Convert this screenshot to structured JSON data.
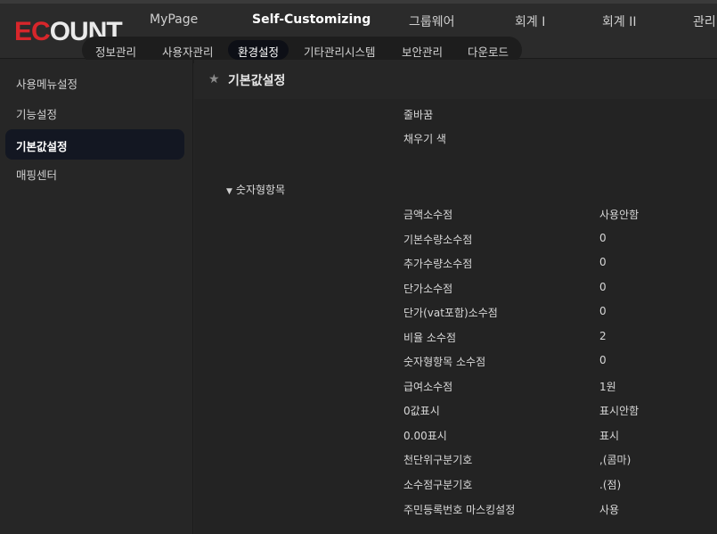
{
  "logo": {
    "part1": "EC",
    "part2": "OUNT"
  },
  "main_nav": [
    "MyPage",
    "Self-Customizing",
    "그룹웨어",
    "회계 I",
    "회계 II",
    "관리"
  ],
  "main_nav_active": "Self-Customizing",
  "sub_nav": [
    "정보관리",
    "사용자관리",
    "환경설정",
    "기타관리시스템",
    "보안관리",
    "다운로드"
  ],
  "sub_nav_active": "환경설정",
  "sidebar": [
    "사용메뉴설정",
    "기능설정",
    "기본값설정",
    "매핑센터"
  ],
  "sidebar_active": "기본값설정",
  "page_title": "기본값설정",
  "top_rows": [
    "줄바꿈",
    "채우기 색"
  ],
  "section": {
    "label": "숫자형항목",
    "expanded": true
  },
  "rows": [
    {
      "label": "금액소수점",
      "value": "사용안함"
    },
    {
      "label": "기본수량소수점",
      "value": "0"
    },
    {
      "label": "추가수량소수점",
      "value": "0"
    },
    {
      "label": "단가소수점",
      "value": "0"
    },
    {
      "label": "단가(vat포함)소수점",
      "value": "0"
    },
    {
      "label": "비율 소수점",
      "value": "2"
    },
    {
      "label": "숫자형항목 소수점",
      "value": "0"
    },
    {
      "label": "급여소수점",
      "value": "1원"
    },
    {
      "label": "0값표시",
      "value": "표시안함"
    },
    {
      "label": "0.00표시",
      "value": "표시"
    },
    {
      "label": "천단위구분기호",
      "value": ",(콤마)"
    },
    {
      "label": "소수점구분기호",
      "value": ".(점)"
    },
    {
      "label": "주민등록번호 마스킹설정",
      "value": "사용"
    }
  ],
  "colors": {
    "brand_red": "#d7262b",
    "background": "#262626",
    "active_bg": "#131722"
  }
}
